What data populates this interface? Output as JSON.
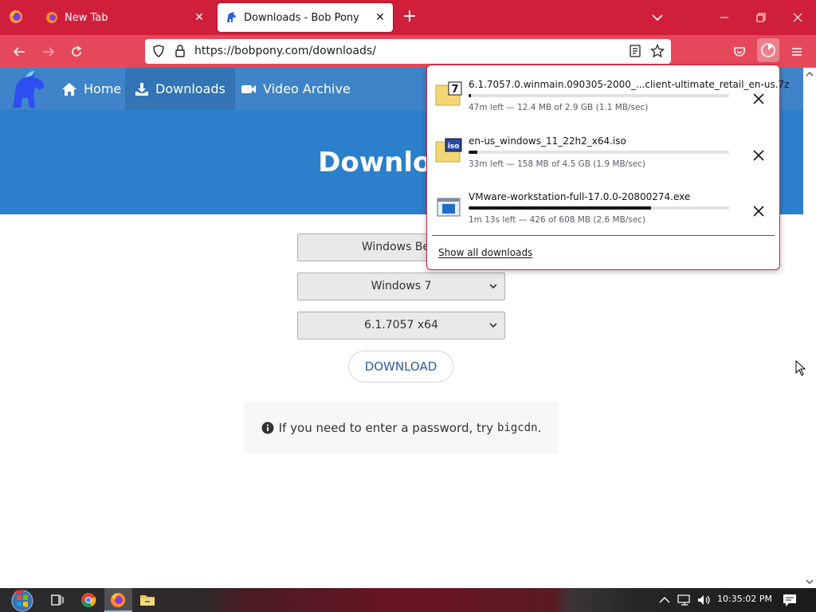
{
  "browser": {
    "tabs": [
      {
        "title": "New Tab",
        "active": false
      },
      {
        "title": "Downloads - Bob Pony",
        "active": true
      }
    ],
    "url": "https://bobpony.com/downloads/",
    "accent_color": "#cf1f3b",
    "toolbar_color": "#e6485b"
  },
  "site": {
    "nav": [
      {
        "label": "Home",
        "icon": "home-icon"
      },
      {
        "label": "Downloads",
        "icon": "download-icon"
      },
      {
        "label": "Video Archive",
        "icon": "video-camera-icon"
      }
    ],
    "hero_title": "Downloads",
    "selects": [
      {
        "value": "Windows Beta"
      },
      {
        "value": "Windows 7"
      },
      {
        "value": "6.1.7057 x64"
      }
    ],
    "download_button": "DOWNLOAD",
    "info_text": "If you need to enter a password, try",
    "info_code": "bigcdn",
    "info_end": "."
  },
  "downloads_panel": {
    "items": [
      {
        "filename": "6.1.7057.0.winmain.090305-2000_...client-ultimate_retail_en-us.7z",
        "status": "47m left — 12.4 MB of 2.9 GB (1.1 MB/sec)",
        "progress": 0.004,
        "icon": "7z-archive-icon"
      },
      {
        "filename": "en-us_windows_11_22h2_x64.iso",
        "status": "33m left — 158 MB of 4.5 GB (1.9 MB/sec)",
        "progress": 0.034,
        "icon": "iso-disc-image-icon"
      },
      {
        "filename": "VMware-workstation-full-17.0.0-20800274.exe",
        "status": "1m 13s left — 426 of 608 MB (2.6 MB/sec)",
        "progress": 0.7,
        "icon": "exe-program-icon"
      }
    ],
    "show_all": "Show all downloads"
  },
  "taskbar": {
    "clock": "10:35:02 PM",
    "apps": [
      "task-view-icon",
      "chrome-icon",
      "firefox-icon",
      "file-explorer-icon"
    ]
  }
}
